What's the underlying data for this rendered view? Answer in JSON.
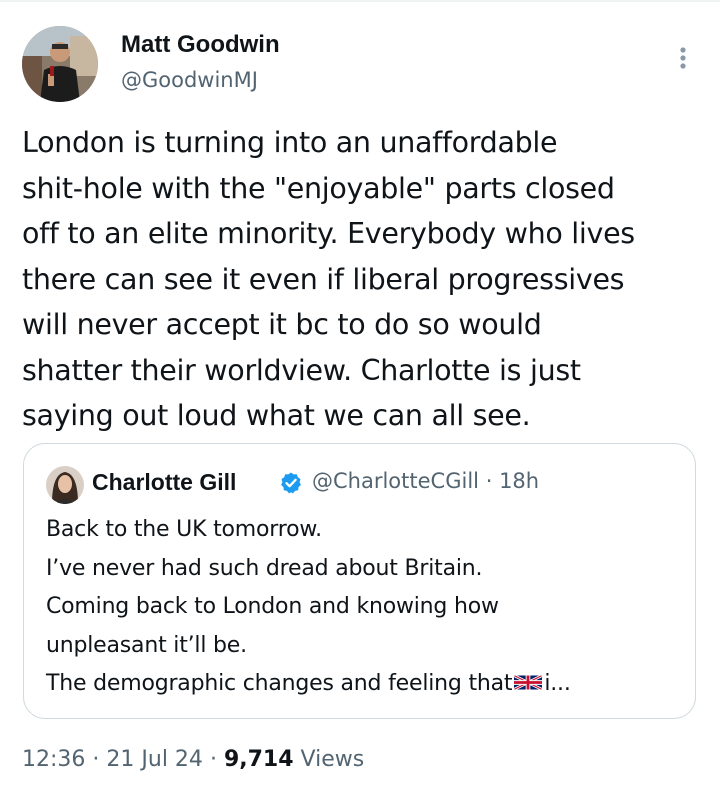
{
  "tweet": {
    "author": {
      "name": "Matt Goodwin",
      "handle": "@GoodwinMJ"
    },
    "text_lines": [
      "London is turning into an unaffordable",
      "shit-hole with the \"enjoyable\" parts closed",
      "off to an elite minority. Everybody who lives",
      "there can see it even if liberal progressives",
      "will never accept it bc to do so would",
      "shatter their worldview. Charlotte is just",
      "saying out loud what we can all see."
    ],
    "time": "12:36",
    "separator": "·",
    "date": "21 Jul 24",
    "views_count": "9,714",
    "views_label": "Views"
  },
  "quote": {
    "author": {
      "name": "Charlotte Gill",
      "handle": "@CharlotteCGill",
      "age": "18h"
    },
    "separator": "·",
    "text_lines": [
      "Back to the UK tomorrow.",
      "I’ve never had such dread about Britain.",
      "Coming back to London and knowing how",
      "unpleasant it’ll be."
    ],
    "last_line_before_flag": "The demographic changes and feeling that",
    "last_line_after_flag": "i...",
    "flag_icon": "uk-flag-icon"
  },
  "colors": {
    "text_primary": "#0f1419",
    "text_secondary": "#536471",
    "verified_blue": "#1d9bf0",
    "border": "#cfd9de"
  },
  "icons": {
    "more": "more-vertical-icon",
    "verified": "verified-badge-icon"
  }
}
